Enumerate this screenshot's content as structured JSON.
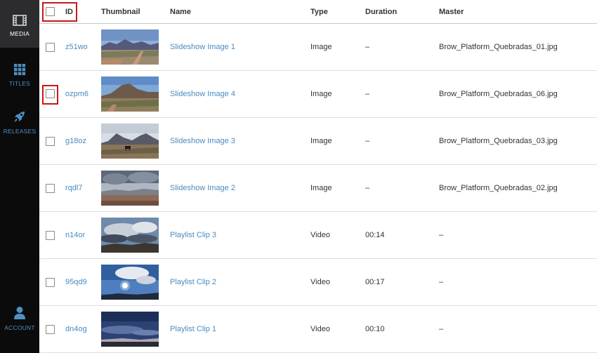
{
  "nav": [
    {
      "key": "media",
      "label": "MEDIA",
      "icon": "film-icon",
      "active": true
    },
    {
      "key": "titles",
      "label": "TITLES",
      "icon": "grid-icon",
      "active": false
    },
    {
      "key": "releases",
      "label": "RELEASES",
      "icon": "rocket-icon",
      "active": false
    },
    {
      "key": "account",
      "label": "ACCOUNT",
      "icon": "user-icon",
      "active": false
    }
  ],
  "columns": {
    "id": "ID",
    "thumbnail": "Thumbnail",
    "name": "Name",
    "type": "Type",
    "duration": "Duration",
    "master": "Master"
  },
  "rows": [
    {
      "id": "z51wo",
      "name": "Slideshow Image 1",
      "type": "Image",
      "duration": "–",
      "master": "Brow_Platform_Quebradas_01.jpg",
      "thumbnail": "desert-road-thumbnail"
    },
    {
      "id": "ozpm6",
      "name": "Slideshow Image 4",
      "type": "Image",
      "duration": "–",
      "master": "Brow_Platform_Quebradas_06.jpg",
      "thumbnail": "mountain-scrub-thumbnail"
    },
    {
      "id": "g18oz",
      "name": "Slideshow Image 3",
      "type": "Image",
      "duration": "–",
      "master": "Brow_Platform_Quebradas_03.jpg",
      "thumbnail": "cattle-valley-thumbnail"
    },
    {
      "id": "rqdl7",
      "name": "Slideshow Image 2",
      "type": "Image",
      "duration": "–",
      "master": "Brow_Platform_Quebradas_02.jpg",
      "thumbnail": "stormy-sky-thumbnail"
    },
    {
      "id": "n14or",
      "name": "Playlist Clip 3",
      "type": "Video",
      "duration": "00:14",
      "master": "–",
      "thumbnail": "cloudy-sky-thumbnail"
    },
    {
      "id": "95qd9",
      "name": "Playlist Clip 2",
      "type": "Video",
      "duration": "00:17",
      "master": "–",
      "thumbnail": "sun-clouds-thumbnail"
    },
    {
      "id": "dn4og",
      "name": "Playlist Clip 1",
      "type": "Video",
      "duration": "00:10",
      "master": "–",
      "thumbnail": "dusk-sky-thumbnail"
    }
  ],
  "colors": {
    "sidebar": "#0b0b0c",
    "sidebar_active": "#2c2c2e",
    "link": "#4a8bc0",
    "highlight": "#c81818"
  }
}
